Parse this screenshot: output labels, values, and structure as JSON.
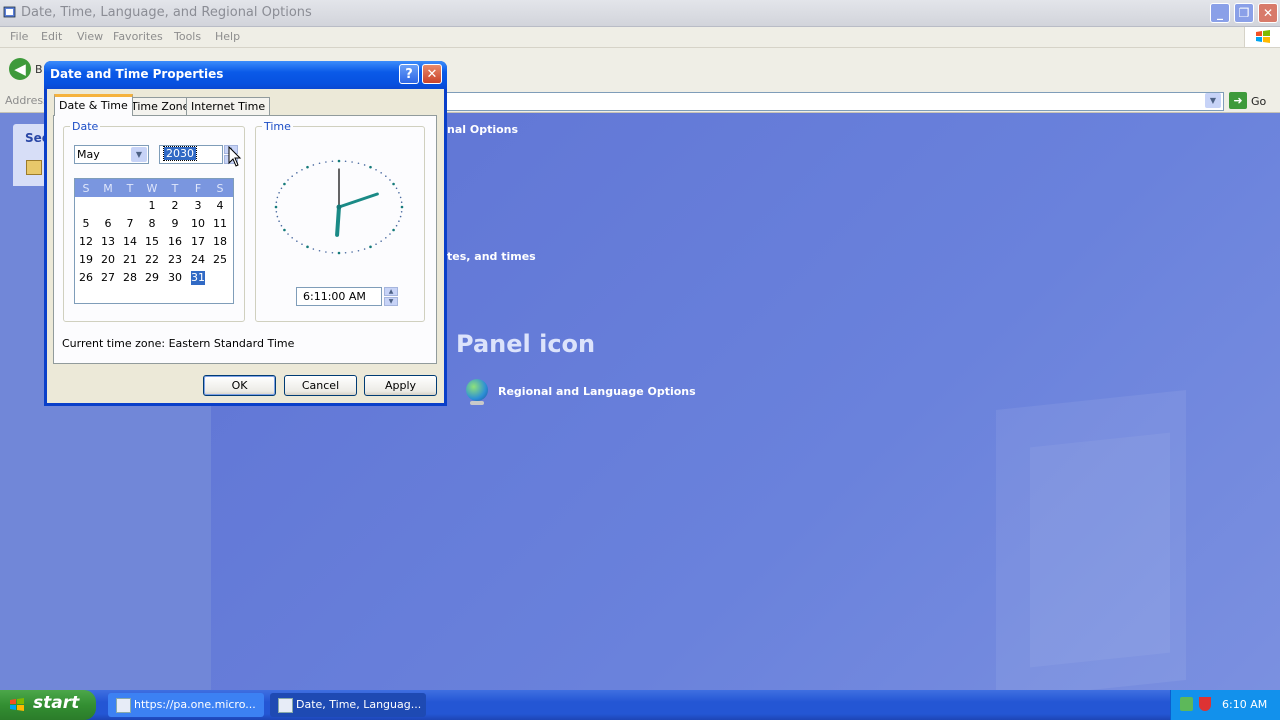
{
  "window": {
    "title": "Date, Time, Language, and Regional Options",
    "menu": [
      "File",
      "Edit",
      "View",
      "Favorites",
      "Tools",
      "Help"
    ],
    "back_label": "B",
    "address_label": "Address",
    "go_label": "Go"
  },
  "sidebar": {
    "see_also_title": "See"
  },
  "content": {
    "link_regional_options": "nal Options",
    "link_dates_times": "tes, and times",
    "panel_icon_heading": "Panel icon",
    "regional_language_link": "Regional and Language Options"
  },
  "dialog": {
    "title": "Date and Time Properties",
    "help_label": "?",
    "close_label": "✕",
    "tabs": [
      {
        "label": "Date & Time",
        "active": true
      },
      {
        "label": "Time Zone",
        "active": false
      },
      {
        "label": "Internet Time",
        "active": false
      }
    ],
    "date_group_label": "Date",
    "time_group_label": "Time",
    "month": "May",
    "year": "2030",
    "weekdays": [
      "S",
      "M",
      "T",
      "W",
      "T",
      "F",
      "S"
    ],
    "calendar_weeks": [
      [
        "",
        "",
        "",
        "1",
        "2",
        "3",
        "4"
      ],
      [
        "5",
        "6",
        "7",
        "8",
        "9",
        "10",
        "11"
      ],
      [
        "12",
        "13",
        "14",
        "15",
        "16",
        "17",
        "18"
      ],
      [
        "19",
        "20",
        "21",
        "22",
        "23",
        "24",
        "25"
      ],
      [
        "26",
        "27",
        "28",
        "29",
        "30",
        "31",
        ""
      ]
    ],
    "selected_day": "31",
    "time_value": "6:11:00 AM",
    "clock": {
      "hour": 6,
      "minute": 11,
      "second": 0
    },
    "current_timezone_label": "Current time zone:  Eastern Standard Time",
    "ok_label": "OK",
    "cancel_label": "Cancel",
    "apply_label": "Apply"
  },
  "taskbar": {
    "start_label": "start",
    "tasks": [
      {
        "label": "https://pa.one.micro...",
        "active": false
      },
      {
        "label": "Date, Time, Languag...",
        "active": true
      }
    ],
    "clock": "6:10 AM"
  },
  "colors": {
    "xp_blue_title": "#0a5ae8",
    "content_blue": "#6375d6",
    "selection_blue": "#316ac5",
    "start_green": "#338f32",
    "tab_active_accent": "#f5b23e"
  }
}
